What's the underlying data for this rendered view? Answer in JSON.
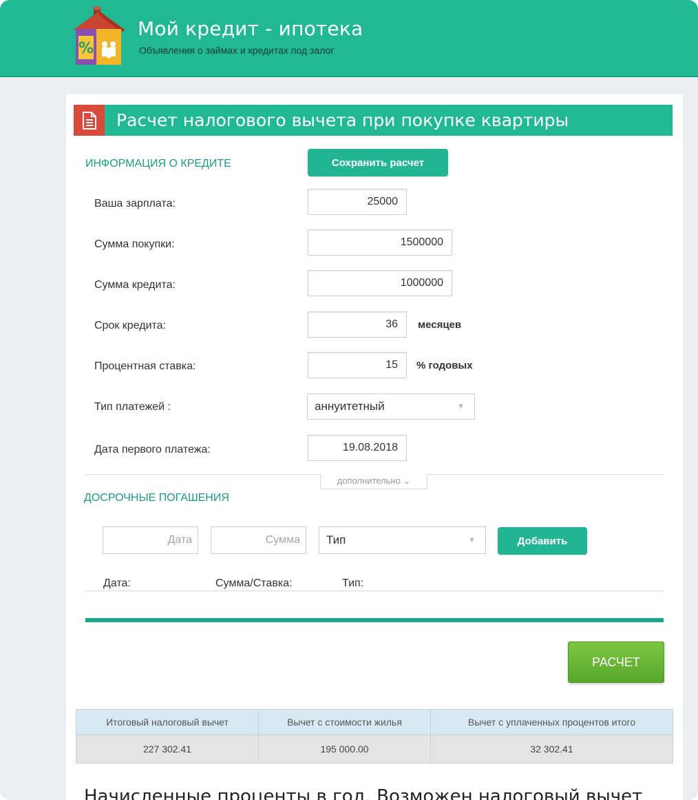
{
  "site": {
    "title": "Мой кредит - ипотека",
    "subtitle": "Объявления о займах и кредитах под залог"
  },
  "section": {
    "title": "Расчет налогового вычета при покупке квартиры"
  },
  "credit_info": {
    "heading": "ИНФОРМАЦИЯ О КРЕДИТЕ",
    "save_button": "Сохранить расчет"
  },
  "fields": {
    "salary": {
      "label": "Ваша зарплата:",
      "value": "25000"
    },
    "purchase": {
      "label": "Сумма покупки:",
      "value": "1500000"
    },
    "loan": {
      "label": "Сумма кредита:",
      "value": "1000000"
    },
    "term": {
      "label": "Срок кредита:",
      "value": "36",
      "unit": "месяцев"
    },
    "rate": {
      "label": "Процентная ставка:",
      "value": "15",
      "unit": "% годовых"
    },
    "payment_type": {
      "label": "Тип платежей :",
      "value": "аннуитетный"
    },
    "first_payment": {
      "label": "Дата первого платежа:",
      "value": "19.08.2018"
    }
  },
  "more_toggle": "дополнительно",
  "prepayments": {
    "heading": "ДОСРОЧНЫЕ ПОГАШЕНИЯ",
    "date_placeholder": "Дата",
    "amount_placeholder": "Сумма",
    "type_value": "Тип",
    "add_button": "Добавить",
    "columns": [
      "Дата:",
      "Сумма/Ставка:",
      "Тип:"
    ]
  },
  "calc_button": "РАСЧЕТ",
  "results": {
    "headers": [
      "Итоговый налоговый вычет",
      "Вычет с стоимости жилья",
      "Вычет с уплаченных процентов итого"
    ],
    "values": [
      "227 302.41",
      "195 000.00",
      "32 302.41"
    ]
  },
  "bottom_heading": "Начисленные проценты в год. Возможен налоговый вычет",
  "colors": {
    "header": "#20b994",
    "accent_text": "#1a9b84",
    "doc_icon_bg": "#d94a3a",
    "calc_button": "#6bb838",
    "table_header": "#d7eaf3"
  }
}
